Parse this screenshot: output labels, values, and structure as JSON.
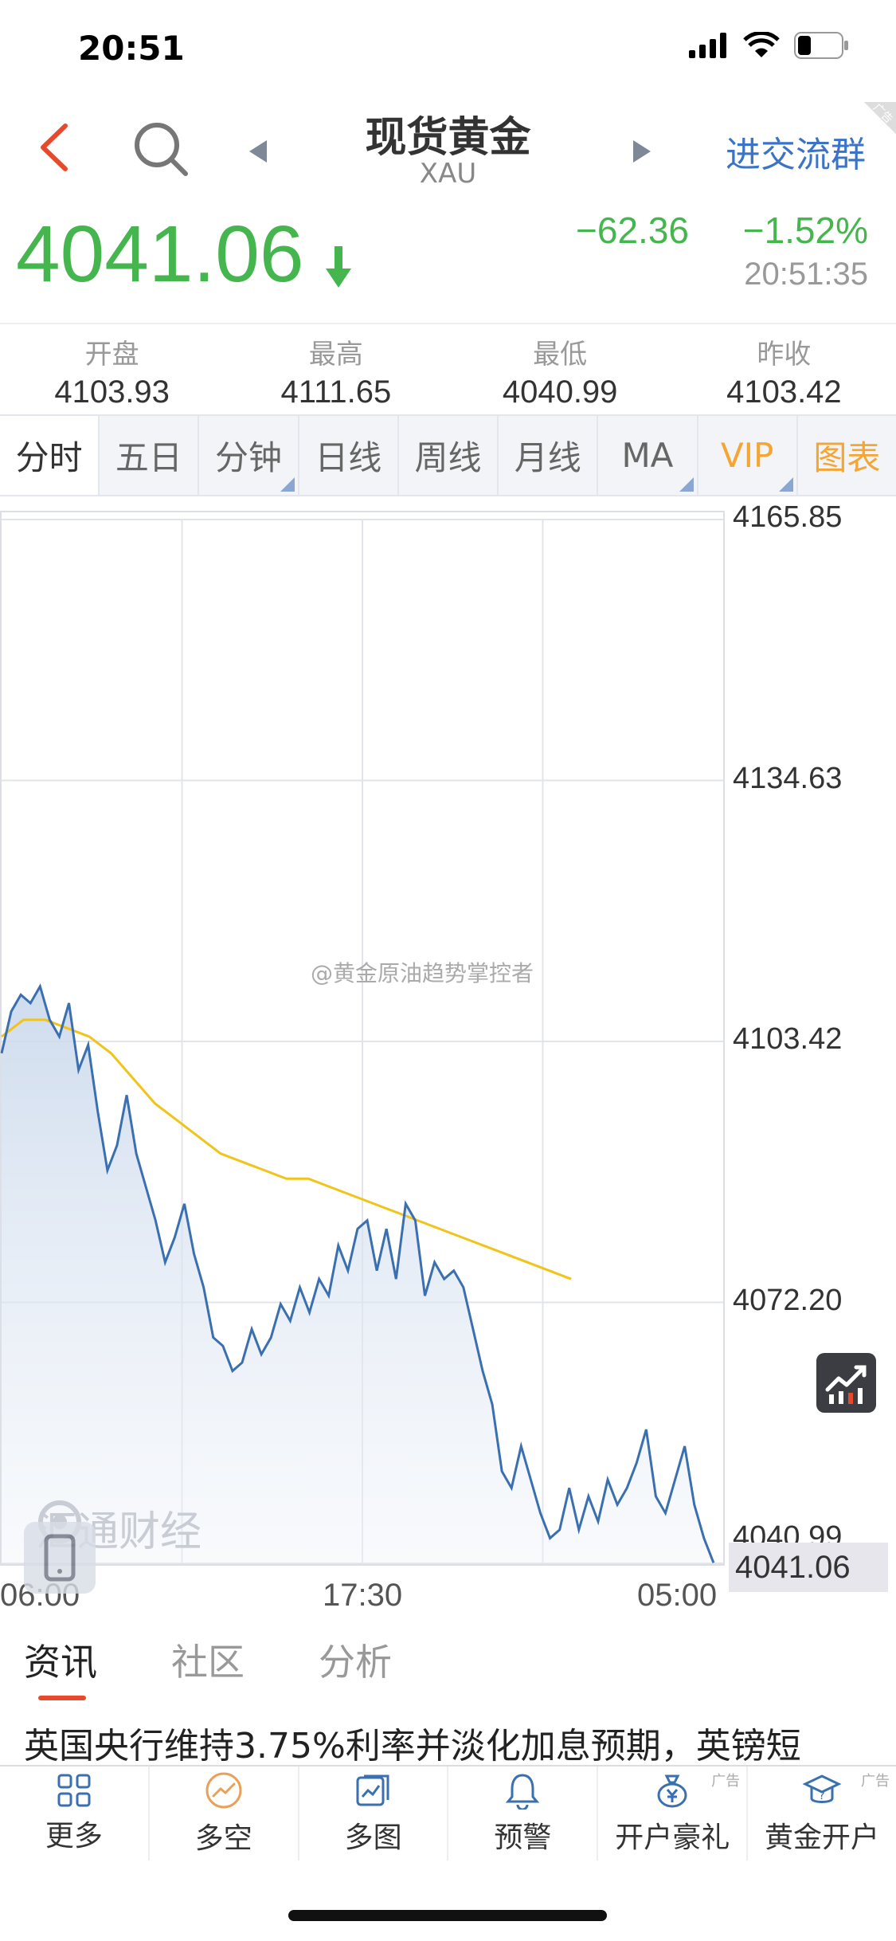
{
  "status": {
    "time": "20:51"
  },
  "nav": {
    "title": "现货黄金",
    "subtitle": "XAU",
    "group_label": "进交流群",
    "ad_label": "广告"
  },
  "quote": {
    "price": "4041.06",
    "change": "−62.36",
    "change_pct": "−1.52%",
    "time": "20:51:35",
    "down_color": "#45b54d"
  },
  "stats": [
    {
      "label": "开盘",
      "value": "4103.93"
    },
    {
      "label": "最高",
      "value": "4111.65"
    },
    {
      "label": "最低",
      "value": "4040.99"
    },
    {
      "label": "昨收",
      "value": "4103.42"
    }
  ],
  "tabs": [
    {
      "label": "分时"
    },
    {
      "label": "五日"
    },
    {
      "label": "分钟"
    },
    {
      "label": "日线"
    },
    {
      "label": "周线"
    },
    {
      "label": "月线"
    },
    {
      "label": "MA"
    },
    {
      "label": "VIP"
    },
    {
      "label": "图表"
    }
  ],
  "chart_data": {
    "type": "line",
    "y_ticks": [
      "4165.85",
      "4134.63",
      "4103.42",
      "4072.20",
      "4040.99"
    ],
    "x_ticks": [
      "06:00",
      "17:30",
      "05:00"
    ],
    "ylim": [
      4040.99,
      4165.85
    ],
    "last_value": "4041.06",
    "series": [
      {
        "kind": "price",
        "color": "#3a6fb0",
        "values": [
          4102,
          4107,
          4109,
          4108,
          4110,
          4106,
          4104,
          4108,
          4100,
          4103,
          4095,
          4088,
          4091,
          4097,
          4090,
          4086,
          4082,
          4077,
          4080,
          4084,
          4078,
          4074,
          4068,
          4067,
          4064,
          4065,
          4069,
          4066,
          4068,
          4072,
          4070,
          4074,
          4071,
          4075,
          4073,
          4079,
          4076,
          4081,
          4082,
          4076,
          4081,
          4075,
          4084,
          4082,
          4073,
          4077,
          4075,
          4076,
          4074,
          4069,
          4064,
          4060,
          4052,
          4050,
          4055,
          4051,
          4047,
          4044,
          4045,
          4050,
          4045,
          4049,
          4046,
          4051,
          4048,
          4050,
          4053,
          4057,
          4049,
          4047,
          4051,
          4055,
          4048,
          4044,
          4041.06
        ]
      },
      {
        "kind": "average",
        "color": "#f0c419",
        "values": [
          4104,
          4106,
          4106,
          4105,
          4104,
          4102,
          4099,
          4096,
          4094,
          4092,
          4090,
          4089,
          4088,
          4087,
          4087,
          4086,
          4085,
          4084,
          4083,
          4082,
          4081,
          4080,
          4079,
          4078,
          4077,
          4076,
          4075
        ]
      }
    ]
  },
  "chart": {
    "watermark": "@黄金原油趋势掌控者",
    "brand": "汇通财经"
  },
  "news": {
    "tabs": [
      {
        "label": "资讯"
      },
      {
        "label": "社区"
      },
      {
        "label": "分析"
      }
    ],
    "headline": "英国央行维持3.75%利率并淡化加息预期，英镑短"
  },
  "bottom_bar": [
    {
      "label": "更多",
      "icon": "grid-icon"
    },
    {
      "label": "多空",
      "icon": "trend-circle-icon"
    },
    {
      "label": "多图",
      "icon": "multi-chart-icon"
    },
    {
      "label": "预警",
      "icon": "bell-icon"
    },
    {
      "label": "开户豪礼",
      "icon": "money-bag-icon",
      "ad": "广告"
    },
    {
      "label": "黄金开户",
      "icon": "help-hat-icon",
      "ad": "广告"
    }
  ]
}
